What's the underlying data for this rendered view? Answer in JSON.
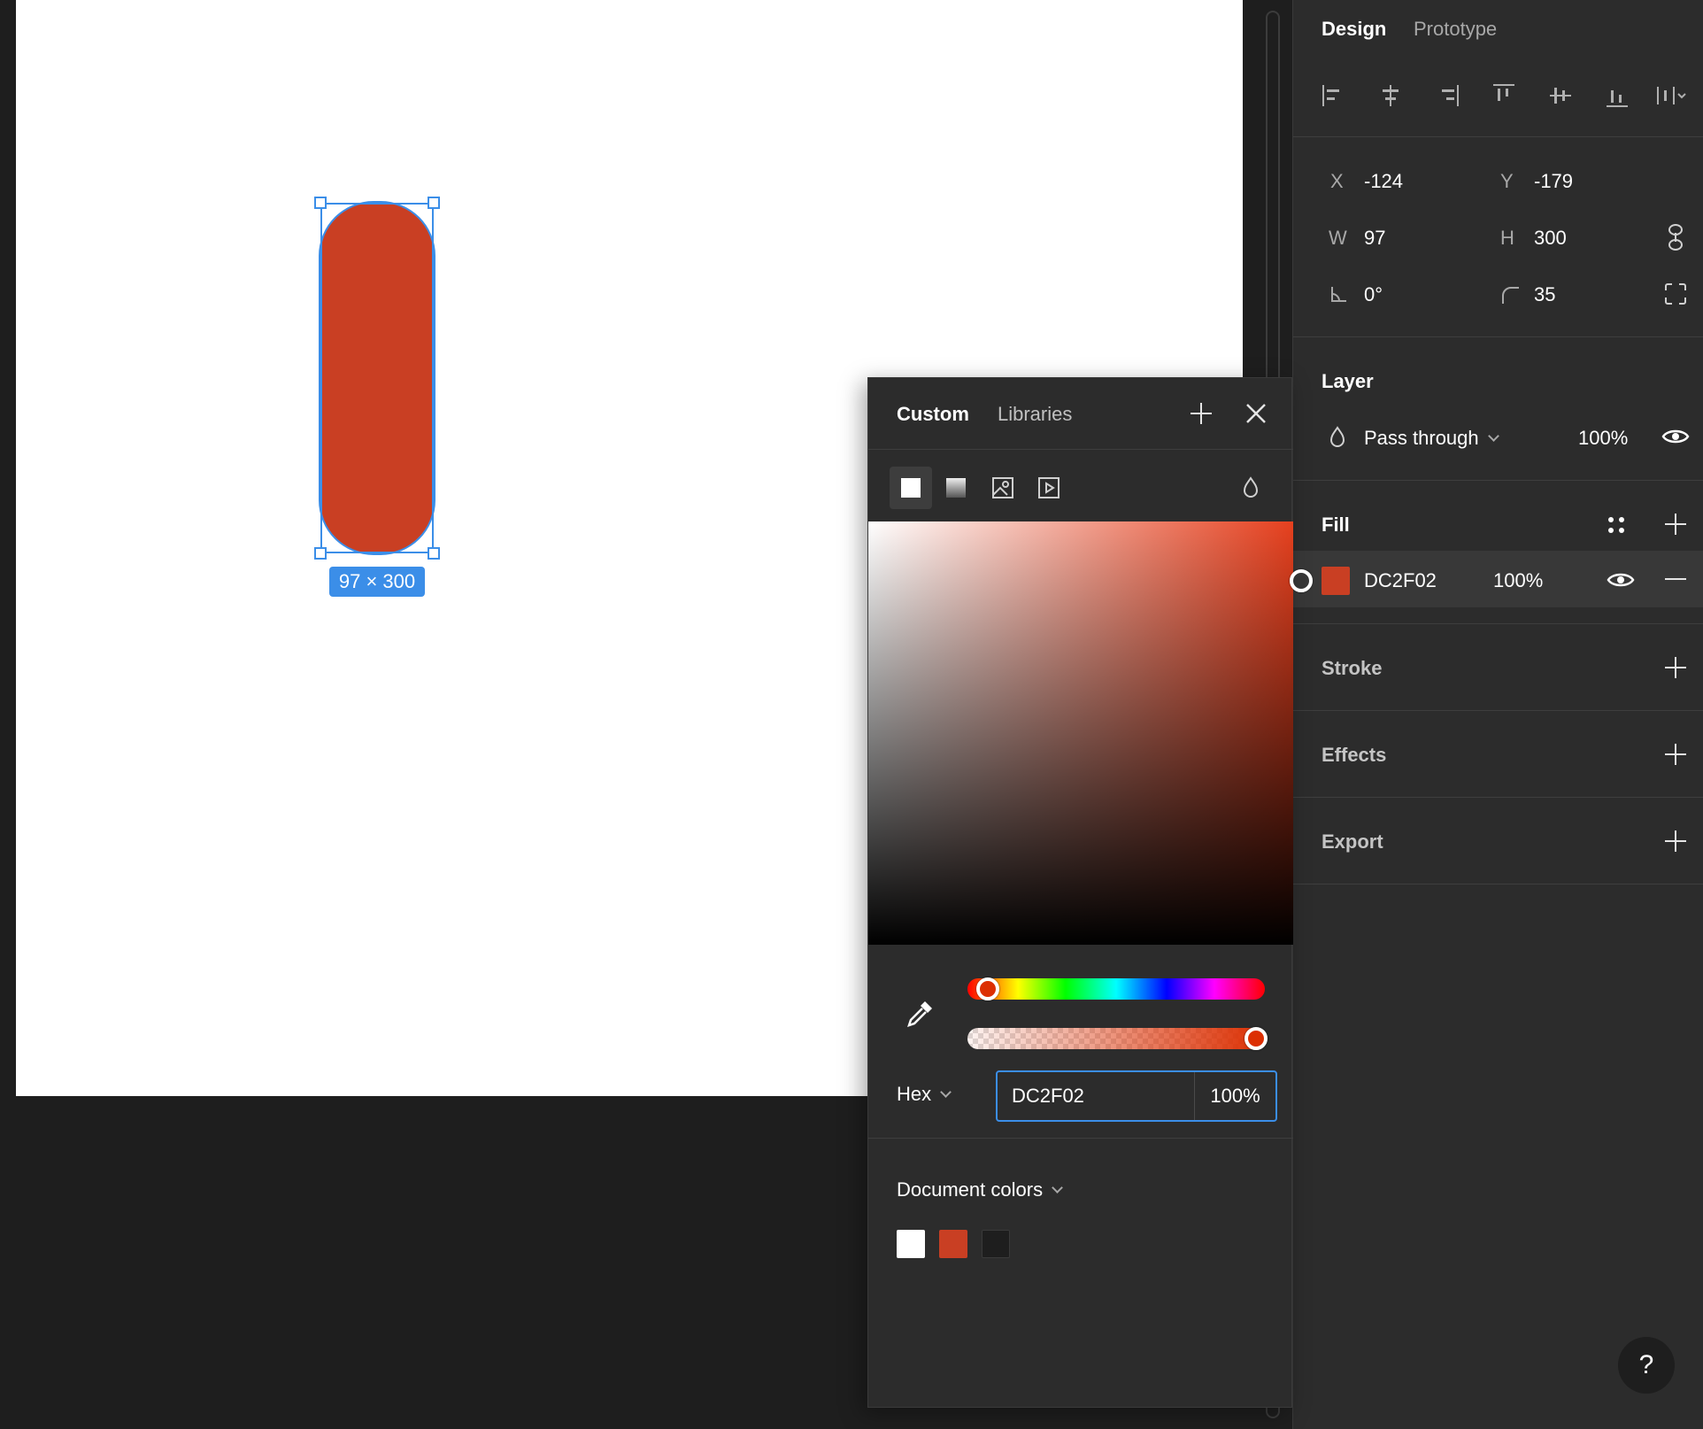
{
  "canvas": {
    "shape_color": "#C93F23",
    "size_badge": "97 × 300"
  },
  "panel": {
    "tabs": {
      "design": "Design",
      "prototype": "Prototype"
    },
    "align_icons": [
      "align-left-icon",
      "align-horizontal-center-icon",
      "align-right-icon",
      "align-top-icon",
      "align-vertical-center-icon",
      "align-bottom-icon",
      "distribute-icon"
    ],
    "geometry": {
      "x_label": "X",
      "x_value": "-124",
      "y_label": "Y",
      "y_value": "-179",
      "w_label": "W",
      "w_value": "97",
      "h_label": "H",
      "h_value": "300",
      "rotation_value": "0°",
      "radius_value": "35"
    },
    "layer": {
      "title": "Layer",
      "blend_mode": "Pass through",
      "opacity": "100%"
    },
    "fill": {
      "title": "Fill",
      "hex": "DC2F02",
      "opacity": "100%",
      "swatch_color": "#C93F23"
    },
    "stroke": {
      "title": "Stroke"
    },
    "effects": {
      "title": "Effects"
    },
    "export": {
      "title": "Export"
    }
  },
  "picker": {
    "tabs": {
      "custom": "Custom",
      "libraries": "Libraries"
    },
    "fill_types": [
      "solid-fill-icon",
      "gradient-fill-icon",
      "image-fill-icon",
      "video-fill-icon"
    ],
    "color_model": "Hex",
    "hex_value": "DC2F02",
    "alpha_value": "100%",
    "document_colors_label": "Document colors",
    "document_colors": [
      "#FFFFFF",
      "#C93F23",
      "#1E1E1E"
    ],
    "hue_color": "#DC2F02",
    "alpha_level": 1.0
  },
  "help": {
    "label": "?"
  }
}
